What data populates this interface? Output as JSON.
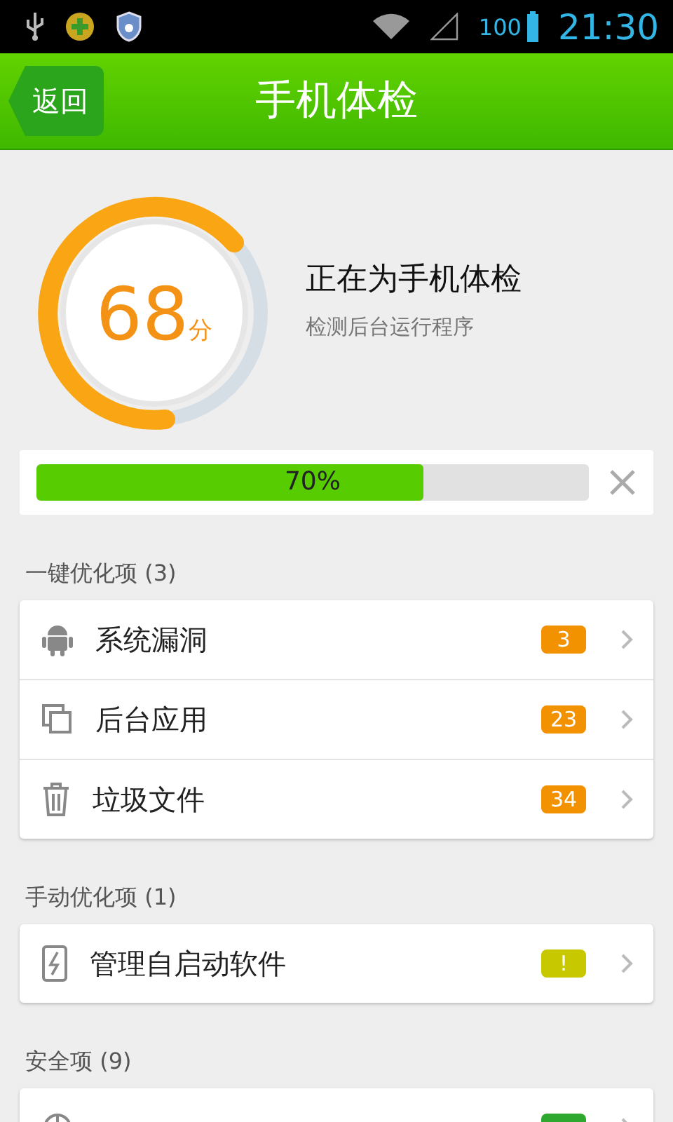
{
  "status_bar": {
    "battery": "100",
    "time": "21:30"
  },
  "header": {
    "back": "返回",
    "title": "手机体检"
  },
  "scan": {
    "score": "68",
    "unit": "分",
    "title": "正在为手机体检",
    "subtitle": "检测后台运行程序"
  },
  "progress": {
    "level": 0.7,
    "label": "70%"
  },
  "sections": [
    {
      "title": "一键优化项 (3)",
      "items": [
        {
          "kind": "android",
          "label": "系统漏洞",
          "badge": "3",
          "color": "#f39200"
        },
        {
          "kind": "apps",
          "label": "后台应用",
          "badge": "23",
          "color": "#f39200"
        },
        {
          "kind": "trash",
          "label": "垃圾文件",
          "badge": "34",
          "color": "#f39200"
        }
      ]
    },
    {
      "title": "手动优化项 (1)",
      "items": [
        {
          "kind": "startup",
          "label": "管理自启动软件",
          "badge": "!",
          "color": "#c8c800"
        }
      ]
    },
    {
      "title": "安全项 (9)",
      "items": [
        {
          "kind": "virus",
          "color": "#2ea82e"
        }
      ]
    }
  ]
}
